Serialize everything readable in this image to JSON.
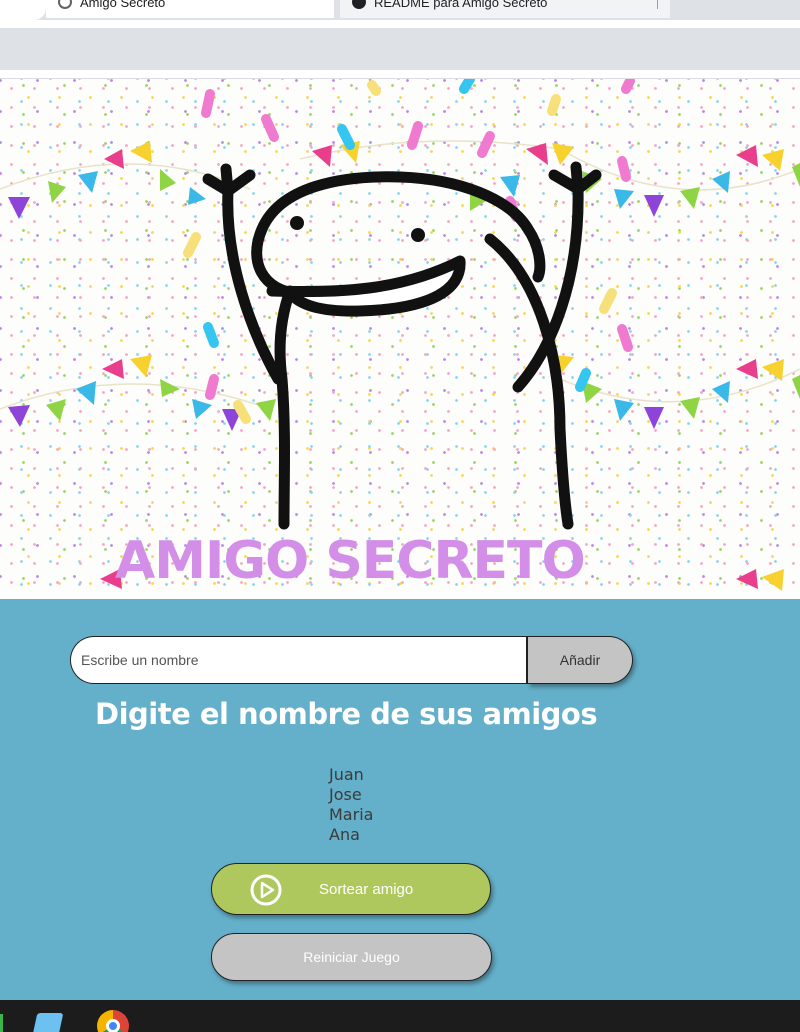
{
  "browser": {
    "tabs": [
      {
        "label": "Amigo Secreto",
        "icon": "globe-icon"
      },
      {
        "label": "README para Amigo Secreto",
        "icon": "github-icon"
      }
    ]
  },
  "hero": {
    "title": "AMIGO SECRETO",
    "title_color": "#d38ee8"
  },
  "form": {
    "input_placeholder": "Escribe un nombre",
    "input_value": "",
    "add_button": "Añadir"
  },
  "section_title": "Digite el nombre de sus amigos",
  "friends": [
    "Juan",
    "Jose",
    "Maria",
    "Ana"
  ],
  "buttons": {
    "draw": "Sortear amigo",
    "draw_icon": "play-circle-icon",
    "reset": "Reiniciar Juego"
  },
  "taskbar": {
    "apps": [
      "app-icon",
      "chrome-icon"
    ]
  },
  "colors": {
    "panel_bg": "#64afc9",
    "draw_button_bg": "#afc85e",
    "add_button_bg": "#c4c4c4",
    "reset_button_bg": "#c4c4c4"
  }
}
